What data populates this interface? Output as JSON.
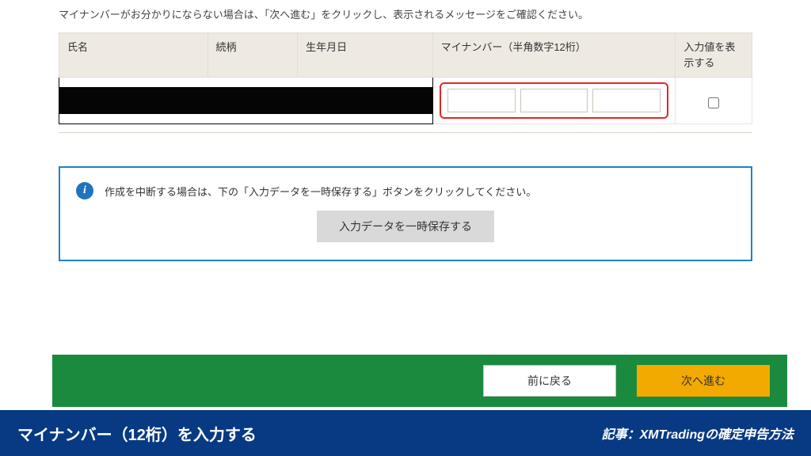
{
  "instruction": "マイナンバーがお分かりにならない場合は、「次へ進む」をクリックし、表示されるメッセージをご確認ください。",
  "table": {
    "headers": {
      "name": "氏名",
      "relation": "続柄",
      "dob": "生年月日",
      "mynumber": "マイナンバー（半角数字12桁）",
      "show": "入力値を表示する"
    },
    "row": {
      "name": "",
      "relation": "",
      "dob": "",
      "mn1": "",
      "mn2": "",
      "mn3": "",
      "show_checked": false
    }
  },
  "info": {
    "text": "作成を中断する場合は、下の「入力データを一時保存する」ボタンをクリックしてください。",
    "save_button": "入力データを一時保存する"
  },
  "nav": {
    "back": "前に戻る",
    "next": "次へ進む"
  },
  "footer": {
    "left": "マイナンバー（12桁）を入力する",
    "right": "記事：XMTradingの確定申告方法"
  }
}
